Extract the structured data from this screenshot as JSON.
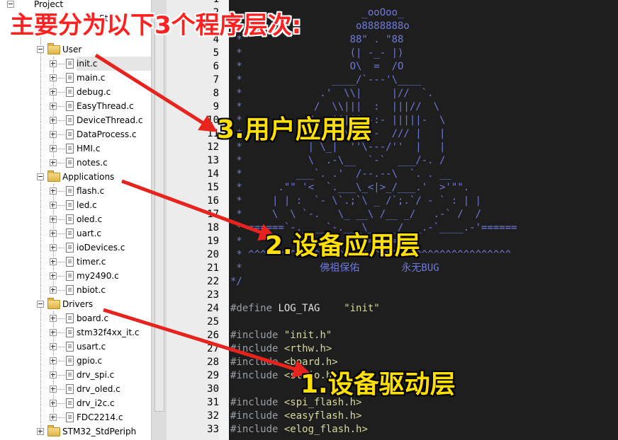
{
  "tree": {
    "top_fragment": "Project",
    "top_fragment2": "St",
    "groups": [
      {
        "name": "User",
        "files": [
          "init.c",
          "main.c",
          "debug.c",
          "EasyThread.c",
          "DeviceThread.c",
          "DataProcess.c",
          "HMI.c",
          "notes.c"
        ]
      },
      {
        "name": "Applications",
        "files": [
          "flash.c",
          "led.c",
          "oled.c",
          "uart.c",
          "ioDevices.c",
          "timer.c",
          "my2490.c",
          "nbiot.c"
        ]
      },
      {
        "name": "Drivers",
        "files": [
          "board.c",
          "stm32f4xx_it.c",
          "usart.c",
          "gpio.c",
          "drv_spi.c",
          "drv_oled.c",
          "drv_i2c.c",
          "FDC2214.c"
        ]
      }
    ],
    "last_group": "STM32_StdPeriph"
  },
  "editor": {
    "line_numbers": [
      "1",
      "2",
      "3",
      "4",
      "5",
      "6",
      "7",
      "8",
      "9",
      "10",
      "11",
      "12",
      "13",
      "14",
      "15",
      "16",
      "17",
      "18",
      "19",
      "20",
      "21",
      "22",
      "23",
      "24",
      "25",
      "26",
      "27",
      "28",
      "29",
      "30",
      "31",
      "32",
      "33"
    ],
    "lines": [
      {
        "cls": "art",
        "text": "                      _ooOoo_"
      },
      {
        "cls": "art",
        "text": "                     o8888888o"
      },
      {
        "cls": "art",
        "text": " *                  88\" . \"88"
      },
      {
        "cls": "art",
        "text": " *                  (| -_- |)"
      },
      {
        "cls": "art",
        "text": " *                  O\\  =  /O"
      },
      {
        "cls": "art",
        "text": " *               ____/`---'\\____"
      },
      {
        "cls": "art",
        "text": " *             .'  \\\\|     |//  `."
      },
      {
        "cls": "art",
        "text": " *            /  \\\\|||  :  |||//  \\"
      },
      {
        "cls": "art",
        "text": " *           /  _||||| -:- |||||-  \\"
      },
      {
        "cls": "art",
        "text": " *           |   | \\\\\\  -  /// |   |"
      },
      {
        "cls": "art",
        "text": " *           | \\_|  ''\\---/''  |   |"
      },
      {
        "cls": "art",
        "text": " *           \\  .-\\__  `-`  ___/-. /"
      },
      {
        "cls": "art",
        "text": " *         ___`. .'  /--.--\\  `. . __"
      },
      {
        "cls": "art",
        "text": " *      .\"\" '<  `.___\\_<|>_/___.'  >'\"\"."
      },
      {
        "cls": "art",
        "text": " *     | | :  `- \\`.;`\\ _ /`;.`/ - ` : | |"
      },
      {
        "cls": "art",
        "text": " *     \\  \\ `-.   \\_ __\\ /__ _/   .-` /  /"
      },
      {
        "cls": "art",
        "text": " * ======`-.____`-.___\\_____/___.-`____.-'======"
      },
      {
        "cls": "art",
        "text": " *                    `=---='"
      },
      {
        "cls": "art",
        "text": " * ^^^^^^^^^^^^^^^^^^^^^^^^^^^^^^^^^^^^^^^^^^^^"
      },
      {
        "cls": "art",
        "text": " *             佛祖保佑       永无BUG"
      },
      {
        "cls": "cmt",
        "text": "*/"
      },
      {
        "cls": "kw",
        "text": ""
      },
      {
        "cls": "kw",
        "text": "#define LOG_TAG    \"init\""
      },
      {
        "cls": "kw",
        "text": ""
      },
      {
        "cls": "kw",
        "text": "#include \"init.h\""
      },
      {
        "cls": "kw",
        "text": "#include <rthw.h>"
      },
      {
        "cls": "kw",
        "text": "#include <board.h>"
      },
      {
        "cls": "kw",
        "text": "#include <stdio.h>"
      },
      {
        "cls": "kw",
        "text": ""
      },
      {
        "cls": "kw",
        "text": "#include <spi_flash.h>"
      },
      {
        "cls": "kw",
        "text": "#include <easyflash.h>"
      },
      {
        "cls": "kw",
        "text": "#include <elog_flash.h>"
      }
    ]
  },
  "annotations": {
    "title": "主要分为以下3个程序层次:",
    "layer3": "3.用户应用层",
    "layer2": "2.设备应用层",
    "layer1": "1.设备驱动层"
  },
  "colors": {
    "annotation_red": "#ff2020",
    "annotation_yellow": "#ffe000",
    "arrow_red": "#e8231e",
    "editor_bg": "#1e1e1e",
    "comment_blue": "#6f79d8"
  }
}
